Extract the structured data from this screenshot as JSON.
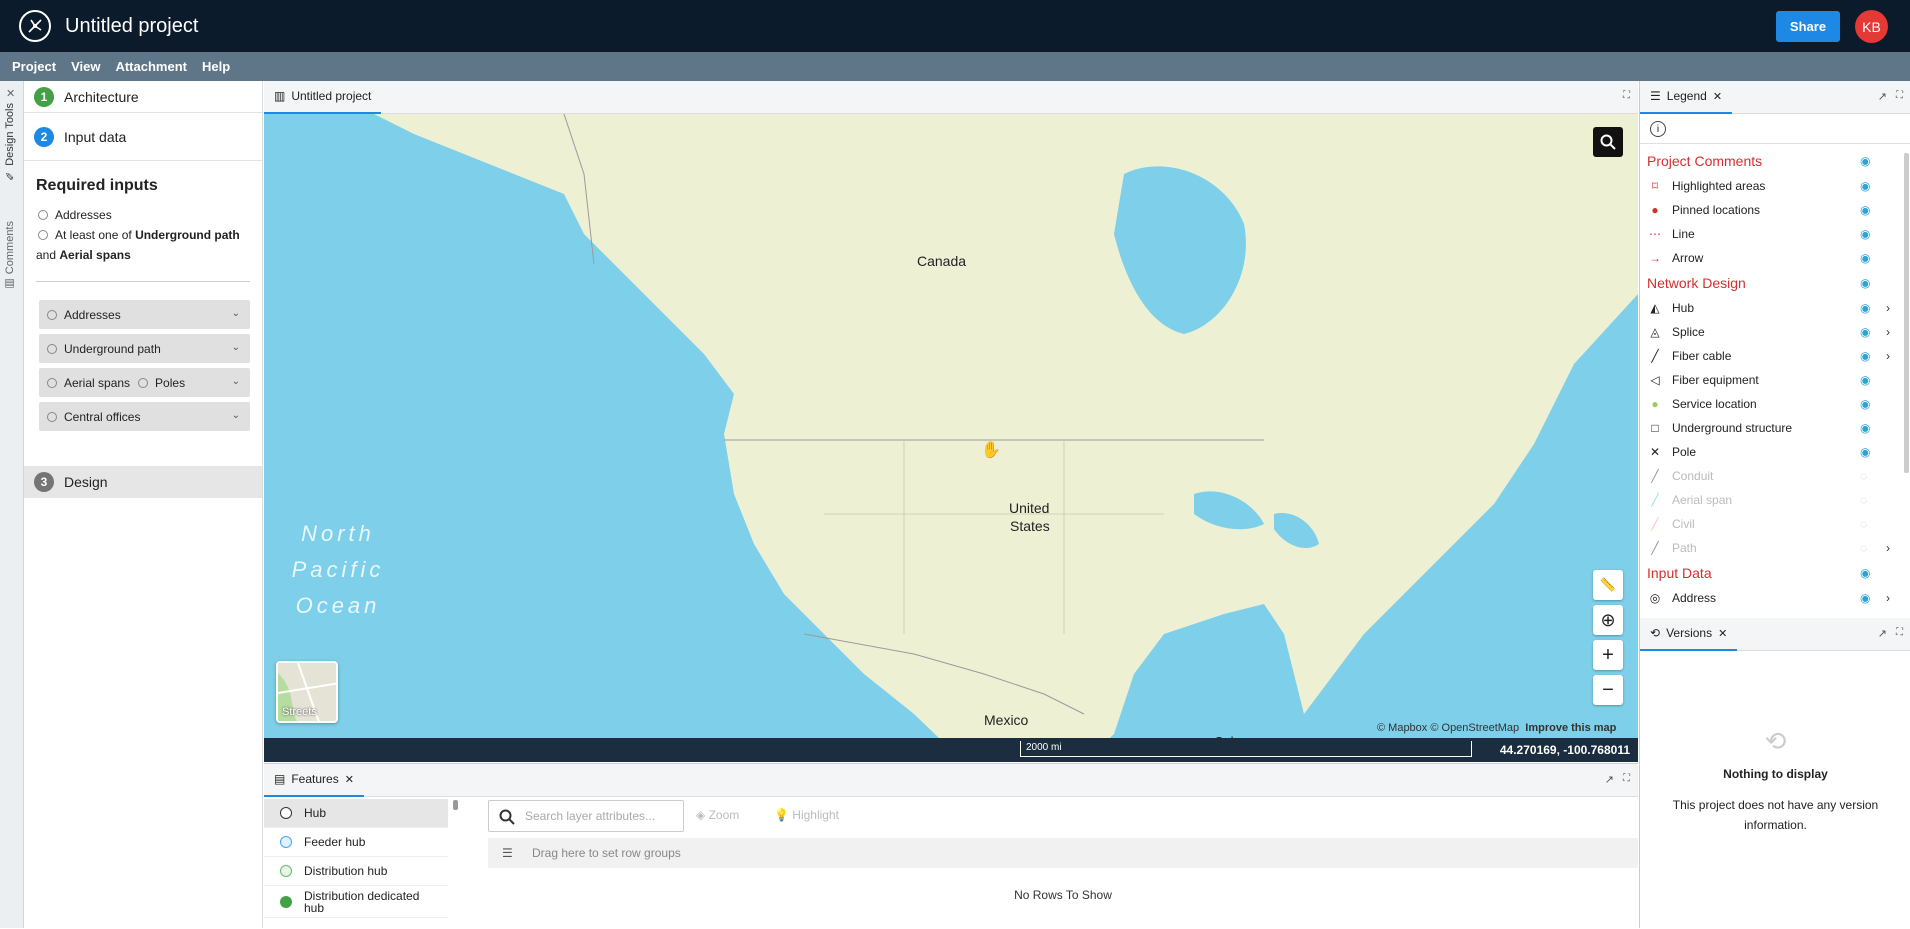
{
  "app": {
    "title": "Untitled project",
    "share_label": "Share",
    "avatar_initials": "KB"
  },
  "menu": [
    "Project",
    "View",
    "Attachment",
    "Help"
  ],
  "vertical_tabs": {
    "design_tools": "Design Tools",
    "comments": "Comments"
  },
  "left_panel": {
    "steps": [
      {
        "num": "1",
        "label": "Architecture",
        "color": "#43a047"
      },
      {
        "num": "2",
        "label": "Input data",
        "color": "#1e88e5"
      },
      {
        "num": "3",
        "label": "Design",
        "color": "#757575"
      }
    ],
    "required_title": "Required inputs",
    "req_addresses": "Addresses",
    "req_line2_a": "At least one of ",
    "req_line2_b": "Underground path",
    "req_line2_c": "and ",
    "req_line2_d": "Aerial spans",
    "data_rows": {
      "addresses": "Addresses",
      "underground": "Underground path",
      "aerial": "Aerial spans",
      "poles": "Poles",
      "central": "Central offices"
    }
  },
  "map_tab": {
    "label": "Untitled project"
  },
  "map": {
    "labels": {
      "canada": "Canada",
      "us_1": "United",
      "us_2": "States",
      "mexico": "Mexico",
      "cuba": "Cuba"
    },
    "ocean": [
      "North",
      "Pacific",
      "Ocean"
    ],
    "streets_label": "Streets",
    "attribution_a": "© Mapbox © OpenStreetMap",
    "attribution_b": "Improve this map",
    "scale_label": "2000 mi",
    "coordinates": "44.270169, -100.768011",
    "colors": {
      "water": "#7ecfe9",
      "land": "#eef0d4"
    }
  },
  "features": {
    "tab_label": "Features",
    "items": [
      {
        "label": "Hub",
        "color": "#333"
      },
      {
        "label": "Feeder hub",
        "color": "#42a5f5"
      },
      {
        "label": "Distribution hub",
        "color": "#66bb6a"
      },
      {
        "label": "Distribution dedicated hub",
        "color": "#43a047"
      }
    ],
    "search_placeholder": "Search layer attributes...",
    "zoom_label": "Zoom",
    "highlight_label": "Highlight",
    "group_hint": "Drag here to set row groups",
    "no_rows": "No Rows To Show"
  },
  "legend": {
    "tab_label": "Legend",
    "sections": {
      "comments": "Project Comments",
      "network": "Network Design",
      "input": "Input Data"
    },
    "comments_items": [
      {
        "label": "Highlighted areas",
        "icon": "⌑",
        "color": "#d32f2f"
      },
      {
        "label": "Pinned locations",
        "icon": "●",
        "color": "#d32f2f"
      },
      {
        "label": "Line",
        "icon": "⋯",
        "color": "#d32f2f"
      },
      {
        "label": "Arrow",
        "icon": "→",
        "color": "#d32f2f"
      }
    ],
    "network_items": [
      {
        "label": "Hub",
        "icon": "◭",
        "color": "#222",
        "visible": true,
        "expand": true
      },
      {
        "label": "Splice",
        "icon": "◬",
        "color": "#222",
        "visible": true,
        "expand": true
      },
      {
        "label": "Fiber cable",
        "icon": "╱",
        "color": "#222",
        "visible": true,
        "expand": true
      },
      {
        "label": "Fiber equipment",
        "icon": "◁",
        "color": "#222",
        "visible": true,
        "expand": false
      },
      {
        "label": "Service location",
        "icon": "●",
        "color": "#9ccc65",
        "visible": true,
        "expand": false
      },
      {
        "label": "Underground structure",
        "icon": "□",
        "color": "#222",
        "visible": true,
        "expand": false
      },
      {
        "label": "Pole",
        "icon": "✕",
        "color": "#222",
        "visible": true,
        "expand": false
      },
      {
        "label": "Conduit",
        "icon": "╱",
        "color": "#222",
        "visible": false,
        "expand": false
      },
      {
        "label": "Aerial span",
        "icon": "╱",
        "color": "#26c6da",
        "visible": false,
        "expand": false
      },
      {
        "label": "Civil",
        "icon": "╱",
        "color": "#ff8a65",
        "visible": false,
        "expand": false
      },
      {
        "label": "Path",
        "icon": "╱",
        "color": "#222",
        "visible": false,
        "expand": true
      }
    ],
    "input_items": [
      {
        "label": "Address",
        "icon": "◎",
        "color": "#222"
      }
    ]
  },
  "versions": {
    "tab_label": "Versions",
    "empty_title": "Nothing to display",
    "empty_text_1": "This project does not have any version",
    "empty_text_2": "information."
  }
}
